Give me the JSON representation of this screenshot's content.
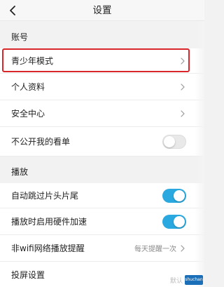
{
  "navbar": {
    "title": "设置",
    "back_icon": "chevron-left-icon"
  },
  "sections": {
    "account": {
      "header": "账号",
      "items": {
        "teen_mode": {
          "label": "青少年模式",
          "icon": "chevron-right-icon"
        },
        "profile": {
          "label": "个人资料",
          "icon": "chevron-right-icon"
        },
        "security": {
          "label": "安全中心",
          "icon": "chevron-right-icon"
        },
        "hide_watching": {
          "label": "不公开我的看单",
          "toggle_on": false
        }
      }
    },
    "playback": {
      "header": "播放",
      "items": {
        "skip_intro": {
          "label": "自动跳过片头片尾",
          "toggle_on": true
        },
        "hw_accel": {
          "label": "播放时启用硬件加速",
          "toggle_on": true
        },
        "non_wifi_reminder": {
          "label": "非wifi网络播放提醒",
          "value": "每天提醒一次",
          "icon": "chevron-right-icon"
        },
        "cast": {
          "label": "投屏设置"
        }
      }
    }
  },
  "highlight": {
    "color": "#d8262a",
    "target": "青少年模式"
  },
  "colors": {
    "accent": "#29a9e0",
    "background": "#f2f2f2",
    "row": "#ffffff"
  },
  "watermark": {
    "text": "默认",
    "logo_text": "shuchan"
  }
}
